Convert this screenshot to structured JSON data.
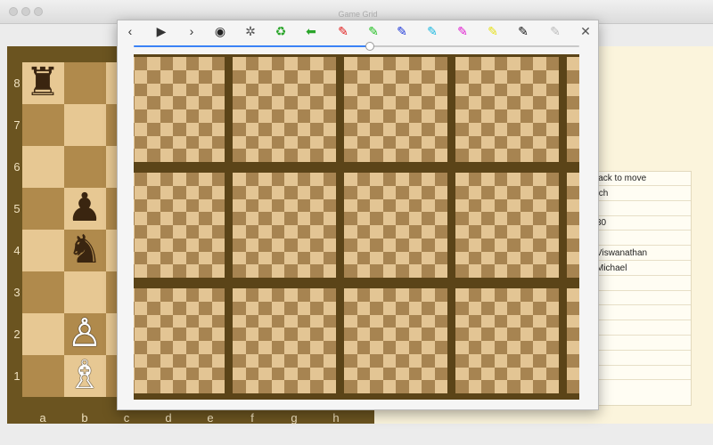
{
  "window": {
    "dialog_title": "Game Grid"
  },
  "board": {
    "ranks": [
      "8",
      "7",
      "6",
      "5",
      "4",
      "3",
      "2",
      "1"
    ],
    "files": [
      "a",
      "b",
      "c",
      "d",
      "e",
      "f",
      "g",
      "h"
    ],
    "light_color": "#e7c893",
    "dark_color": "#b08a4c",
    "pieces": [
      {
        "glyph": "♜",
        "name": "black-rook",
        "file": "a",
        "rank": "8",
        "color": "#3a2510"
      },
      {
        "glyph": "♟",
        "name": "black-pawn",
        "file": "b",
        "rank": "5",
        "color": "#3a2510"
      },
      {
        "glyph": "♞",
        "name": "black-knight",
        "file": "b",
        "rank": "4",
        "color": "#3a2510"
      },
      {
        "glyph": "♙",
        "name": "white-pawn",
        "file": "b",
        "rank": "2",
        "color": "#ffffff"
      },
      {
        "glyph": "♗",
        "name": "white-bishop",
        "file": "b",
        "rank": "1",
        "color": "#ffffff"
      }
    ]
  },
  "info_panel": {
    "rows": [
      "lack to move",
      "/ch",
      "",
      "30",
      "",
      "Viswanathan",
      "Michael",
      "",
      "",
      "",
      "",
      "",
      "",
      ""
    ]
  },
  "toolbar": {
    "items": [
      {
        "name": "back-icon",
        "glyph": "‹",
        "color": "#333"
      },
      {
        "name": "play-icon",
        "glyph": "▶",
        "color": "#333"
      },
      {
        "name": "forward-icon",
        "glyph": "›",
        "color": "#333"
      },
      {
        "name": "aperture-icon",
        "glyph": "◉",
        "color": "#222"
      },
      {
        "name": "film-reel-icon",
        "glyph": "✲",
        "color": "#555"
      },
      {
        "name": "recycle-icon",
        "glyph": "♻",
        "color": "#2aa52a"
      },
      {
        "name": "green-arrow-icon",
        "glyph": "⬅",
        "color": "#2aa52a"
      },
      {
        "name": "red-pen-icon",
        "glyph": "✎",
        "color": "#e01b1b"
      },
      {
        "name": "green-pen-icon",
        "glyph": "✎",
        "color": "#22c022"
      },
      {
        "name": "blue-pen-icon",
        "glyph": "✎",
        "color": "#1c36d8"
      },
      {
        "name": "cyan-pen-icon",
        "glyph": "✎",
        "color": "#19b7e0"
      },
      {
        "name": "magenta-pen-icon",
        "glyph": "✎",
        "color": "#e01bd0"
      },
      {
        "name": "yellow-pen-icon",
        "glyph": "✎",
        "color": "#e6e01b"
      },
      {
        "name": "black-pen-icon",
        "glyph": "✎",
        "color": "#111111"
      },
      {
        "name": "eraser-pen-icon",
        "glyph": "✎",
        "color": "#bbbbbb"
      },
      {
        "name": "close-icon",
        "glyph": "✕",
        "color": "#555"
      }
    ],
    "slider_value": 0.53
  },
  "grid": {
    "rows": 3,
    "cols": 5,
    "light_color": "#e3c594",
    "dark_color": "#a78451"
  }
}
